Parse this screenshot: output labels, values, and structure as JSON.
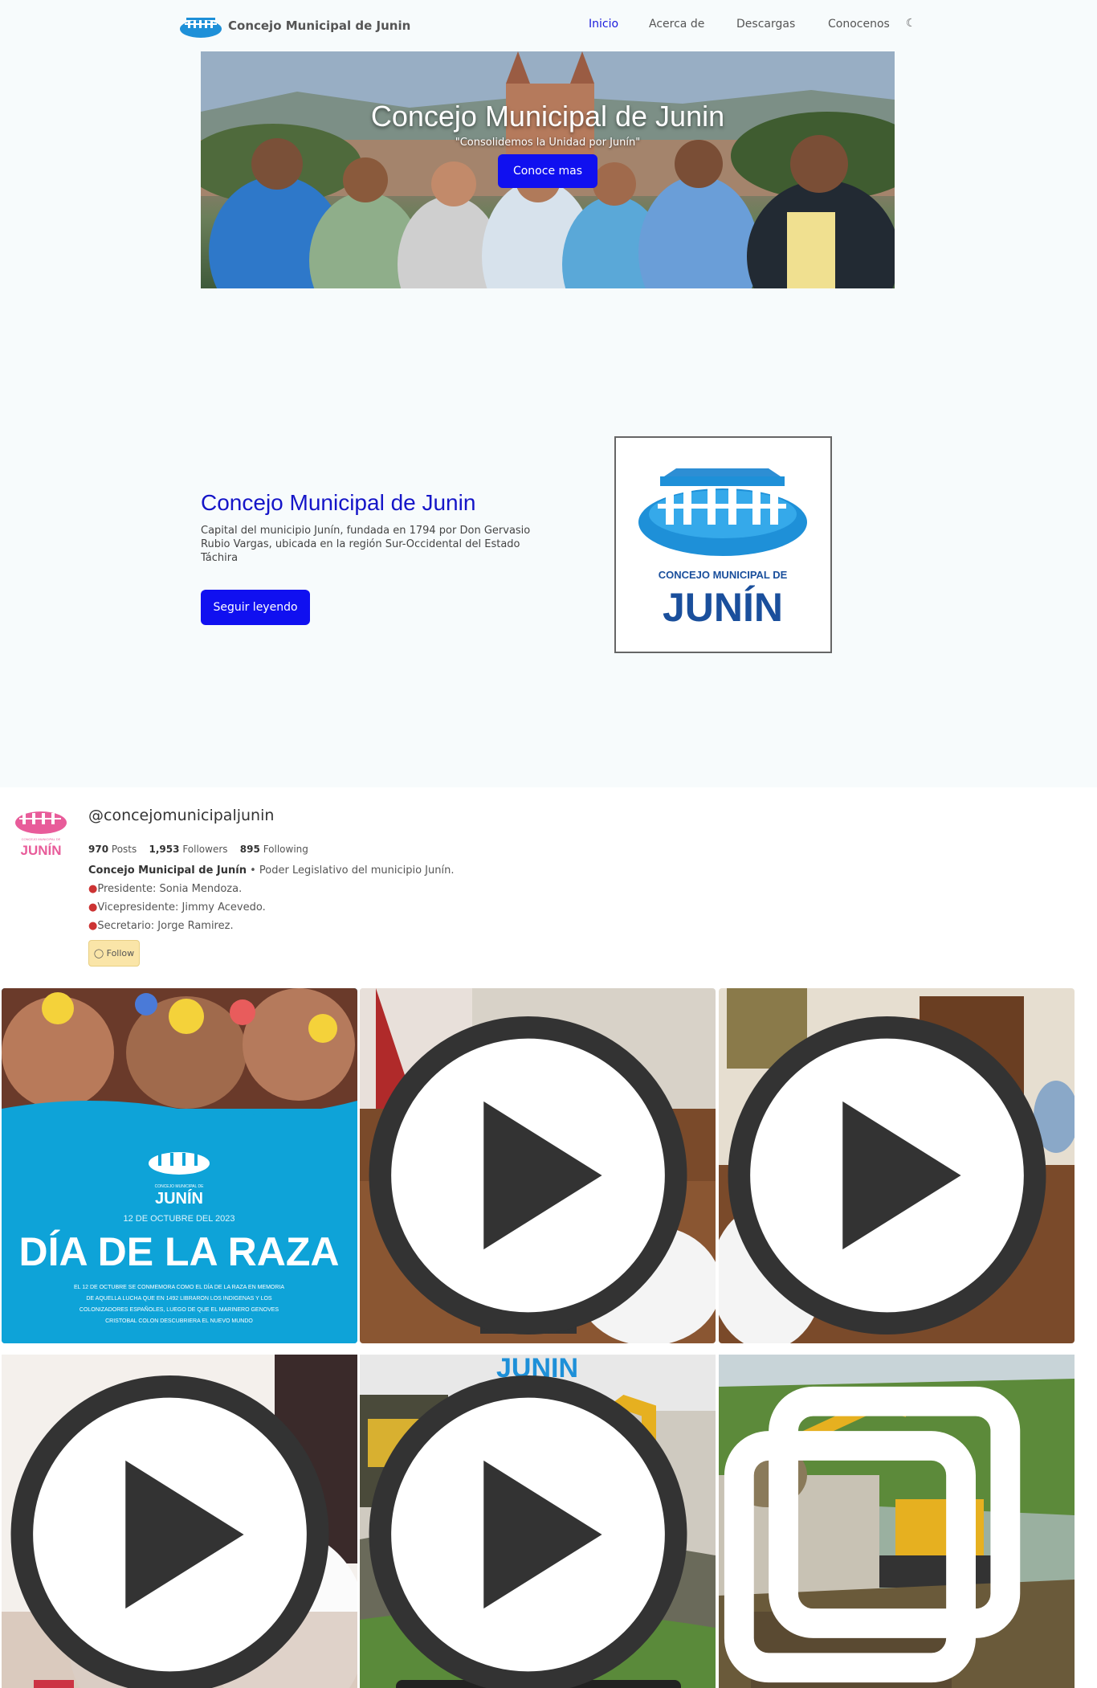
{
  "nav": {
    "brand": "Concejo Municipal de Junin",
    "links": [
      "Inicio",
      "Acerca de",
      "Descargas",
      "Conocenos"
    ],
    "active": "Inicio",
    "theme_icon": "moon-icon"
  },
  "hero": {
    "title": "Concejo Municipal de Junin",
    "subtitle": "\"Consolidemos la Unidad por Junín\"",
    "button": "Conoce mas"
  },
  "about": {
    "title": "Concejo Municipal de Junin",
    "text": "Capital del municipio Junín, fundada en 1794 por Don Gervasio Rubio Vargas, ubicada en la región Sur-Occidental del Estado Táchira",
    "button": "Seguir leyendo",
    "logo_line1": "CONCEJO MUNICIPAL DE",
    "logo_line2": "JUNÍN"
  },
  "instagram": {
    "handle": "@concejomunicipaljunin",
    "avatar_line1": "CONCEJO MUNICIPAL DE",
    "avatar_line2": "JUNÍN",
    "posts": "970",
    "posts_label": "Posts",
    "followers": "1,953",
    "followers_label": "Followers",
    "following": "895",
    "following_label": "Following",
    "bio_name": "Concejo Municipal de Junín",
    "bio_desc": " • Poder Legislativo del municipio Junín.",
    "bio_lines": [
      "Presidente: Sonia Mendoza.",
      "Vicepresidente: Jimmy Acevedo.",
      "Secretario: Jorge Ramirez."
    ],
    "follow_label": "Follow",
    "tile1": {
      "logo_small": "CONCEJO MUNICIPAL DE",
      "logo_big": "JUNÍN",
      "date": "12 DE OCTUBRE DEL 2023",
      "title": "DÍA DE LA RAZA",
      "caption": [
        "EL 12 DE OCTUBRE SE CONMEMORA COMO EL DÍA DE LA RAZA EN MEMORIA",
        "DE AQUELLA LUCHA QUE EN 1492 LIBRARON LOS INDIGENAS Y LOS",
        "COLONIZADORES ESPAÑOLES, LUEGO DE QUE EL MARINERO GENOVES",
        "CRISTOBAL COLON DESCUBRIERA EL NUEVO MUNDO"
      ]
    },
    "tile5_banner": "JUNIN",
    "tile_types": [
      "image",
      "video",
      "video",
      "video",
      "video",
      "carousel"
    ]
  },
  "colors": {
    "accent": "#1010f0",
    "title_blue": "#1515c8",
    "logo_blue": "#1e90d8",
    "logo_navy": "#1a4f9c",
    "insta_pink": "#e85c9a",
    "follow_bg": "#fae5a8"
  }
}
